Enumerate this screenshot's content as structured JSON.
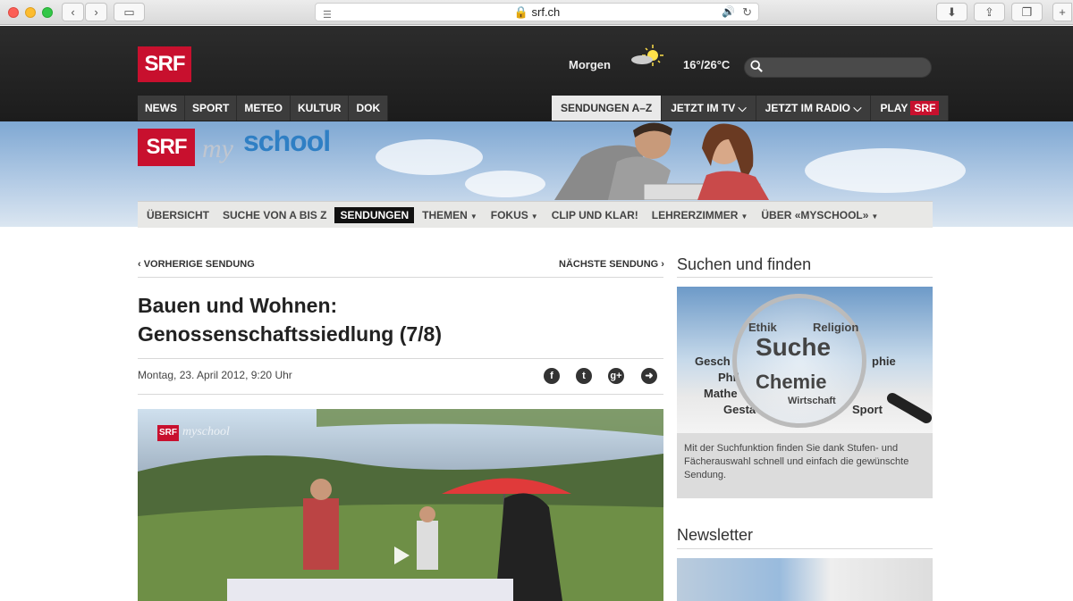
{
  "browser": {
    "url": "srf.ch"
  },
  "header": {
    "logo": "SRF",
    "weather_label": "Morgen",
    "temperature": "16°/26°C",
    "search_placeholder": "",
    "nav_left": [
      "NEWS",
      "SPORT",
      "METEO",
      "KULTUR",
      "DOK"
    ],
    "nav_right": [
      {
        "label": "SENDUNGEN A–Z",
        "active": true
      },
      {
        "label": "JETZT IM TV ⌵"
      },
      {
        "label": "JETZT IM RADIO ⌵"
      }
    ],
    "play_label": "PLAY",
    "play_badge": "SRF"
  },
  "banner": {
    "logo": "SRF",
    "my": "my",
    "school": "school"
  },
  "subnav": [
    {
      "label": "ÜBERSICHT"
    },
    {
      "label": "SUCHE VON A BIS Z"
    },
    {
      "label": "SENDUNGEN",
      "active": true
    },
    {
      "label": "THEMEN",
      "caret": true
    },
    {
      "label": "FOKUS",
      "caret": true
    },
    {
      "label": "CLIP UND KLAR!"
    },
    {
      "label": "LEHRERZIMMER",
      "caret": true
    },
    {
      "label": "ÜBER «MYSCHOOL»",
      "caret": true
    }
  ],
  "article": {
    "prev": "‹  VORHERIGE SENDUNG",
    "next": "NÄCHSTE SENDUNG  ›",
    "title_line1": "Bauen und Wohnen:",
    "title_line2": "Genossenschaftssiedlung (7/8)",
    "date": "Montag, 23. April 2012, 9:20 Uhr",
    "share_icons": [
      "facebook-icon",
      "twitter-icon",
      "google-plus-icon",
      "share-icon"
    ],
    "video_logo": "SRF",
    "video_my": "myschool"
  },
  "sidebar": {
    "search_heading": "Suchen und finden",
    "search_text": "Mit der Suchfunktion finden Sie dank Stufen- und Fächerauswahl schnell und einfach die gewünschte Sendung.",
    "newsletter_heading": "Newsletter",
    "words": {
      "suche": "Suche",
      "chemie": "Chemie",
      "ethik": "Ethik",
      "religion": "Religion",
      "geschichte": "Gesch",
      "phil": "Phil",
      "mathe": "Mathe",
      "gesta": "Gesta",
      "sport": "Sport",
      "phie": "phie",
      "wirtschaft": "Wirtschaft"
    }
  },
  "colors": {
    "srf_red": "#c8102e",
    "header_bg": "#222222",
    "school_blue": "#2f7fc4"
  }
}
